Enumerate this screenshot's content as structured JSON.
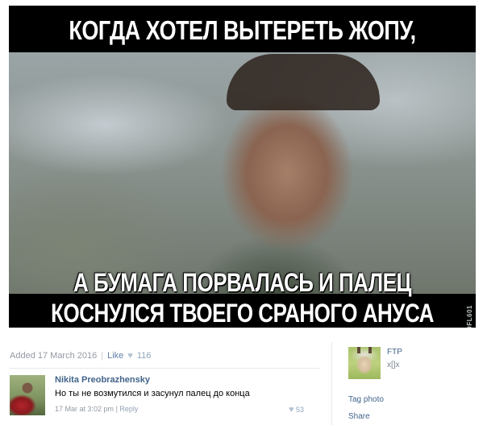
{
  "meme": {
    "caption_top": "КОГДА ХОТЕЛ ВЫТЕРЕТЬ ЖОПУ,",
    "caption_bottom_line1": "А БУМАГА ПОРВАЛАСЬ И ПАЛЕЦ",
    "caption_bottom_line2": "КОСНУЛСЯ ТВОЕГО СРАНОГО АНУСА",
    "watermark": "ROFL601"
  },
  "post_meta": {
    "added": "Added 17 March 2016",
    "separator": "|",
    "like_label": "Like",
    "like_icon": "heart-icon",
    "like_count": "116"
  },
  "comment": {
    "author": "Nikita Preobrazhensky",
    "text": "Но ты не возмутился и засунул палец до конца",
    "time": "17 Mar at 3:02 pm",
    "separator": "|",
    "reply_label": "Reply",
    "like_icon": "heart-icon",
    "like_count": "53"
  },
  "sidebar": {
    "group_name": "FTP",
    "group_sub": "x[]x",
    "tag_photo": "Tag photo",
    "share": "Share"
  }
}
